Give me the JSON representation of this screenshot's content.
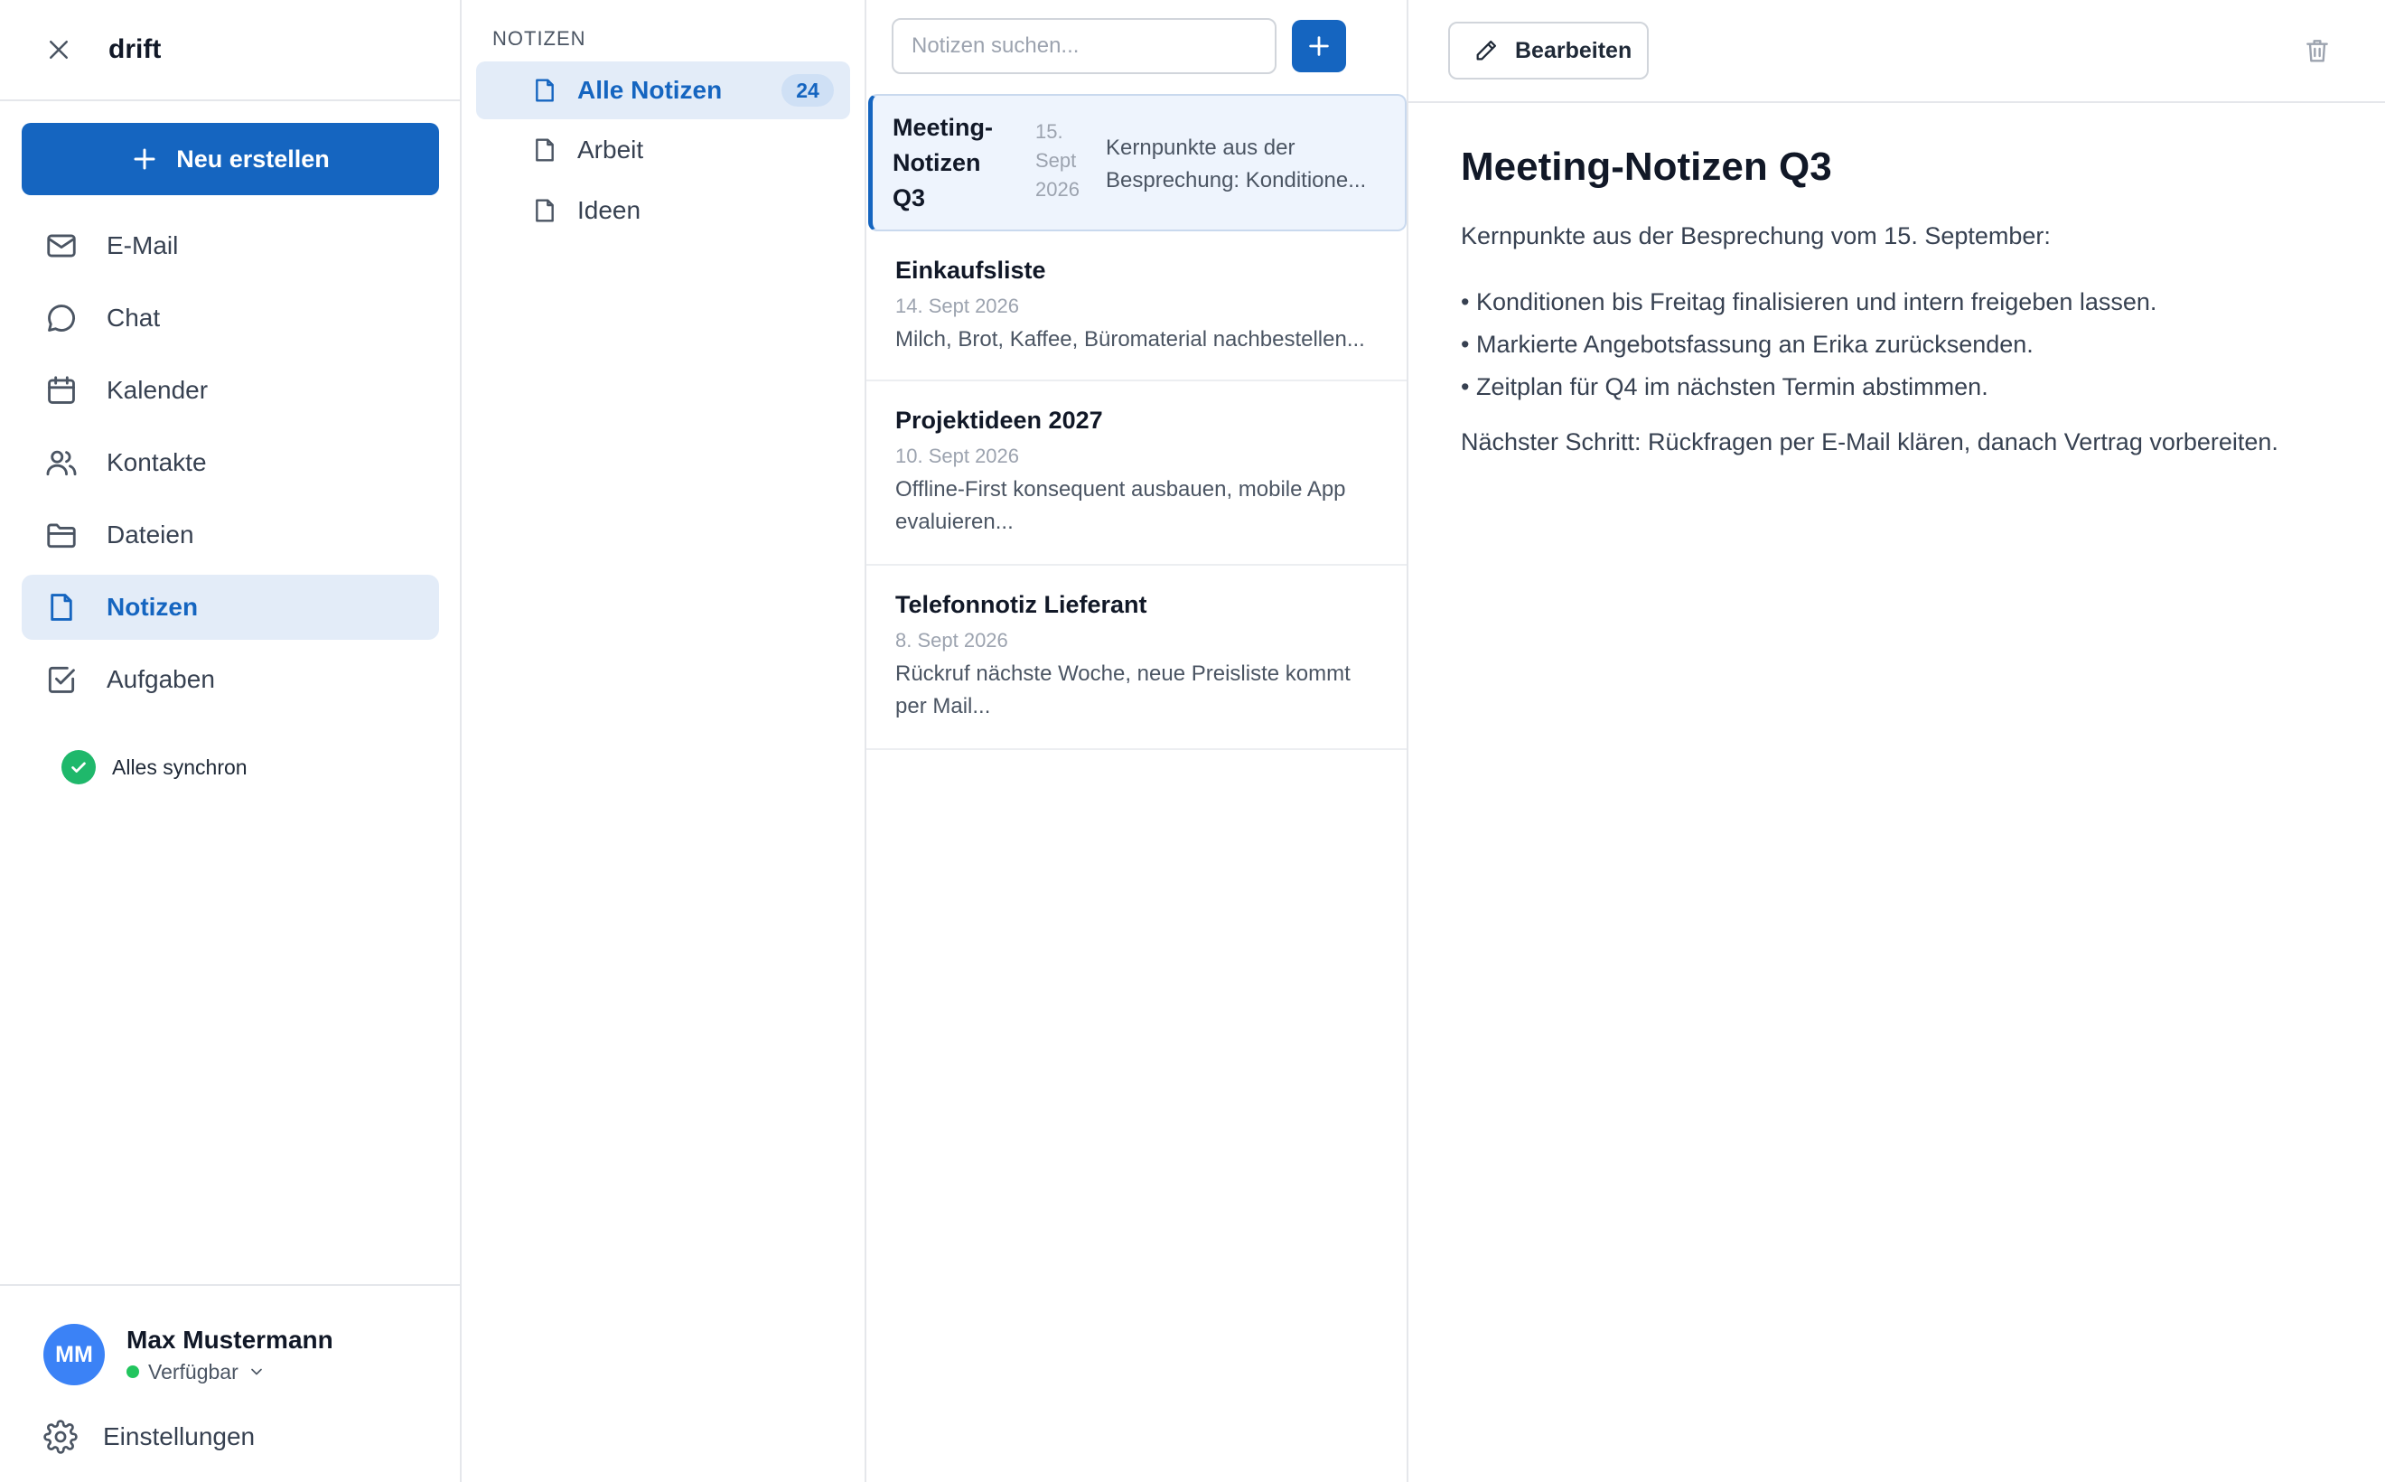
{
  "app": {
    "name": "drift"
  },
  "sidebar": {
    "new_button": "Neu erstellen",
    "items": [
      {
        "label": "E-Mail",
        "icon": "mail-icon"
      },
      {
        "label": "Chat",
        "icon": "chat-icon"
      },
      {
        "label": "Kalender",
        "icon": "calendar-icon"
      },
      {
        "label": "Kontakte",
        "icon": "contacts-icon"
      },
      {
        "label": "Dateien",
        "icon": "folder-icon"
      },
      {
        "label": "Notizen",
        "icon": "note-icon",
        "active": true
      },
      {
        "label": "Aufgaben",
        "icon": "task-icon"
      }
    ],
    "sync_status": "Alles synchron"
  },
  "user": {
    "initials": "MM",
    "name": "Max Mustermann",
    "status": "Verfügbar"
  },
  "settings_label": "Einstellungen",
  "folders": {
    "title": "NOTIZEN",
    "items": [
      {
        "label": "Alle Notizen",
        "count": "24",
        "active": true
      },
      {
        "label": "Arbeit"
      },
      {
        "label": "Ideen"
      }
    ]
  },
  "notes": {
    "search_placeholder": "Notizen suchen...",
    "items": [
      {
        "title": "Meeting-Notizen Q3",
        "date": "15. Sept 2026",
        "preview": "Kernpunkte aus der Besprechung: Konditione...",
        "active": true
      },
      {
        "title": "Einkaufsliste",
        "date": "14. Sept 2026",
        "preview": "Milch, Brot, Kaffee, Büromaterial nachbestellen..."
      },
      {
        "title": "Projektideen 2027",
        "date": "10. Sept 2026",
        "preview": "Offline-First konsequent ausbauen, mobile App evaluieren..."
      },
      {
        "title": "Telefonnotiz Lieferant",
        "date": "8. Sept 2026",
        "preview": "Rückruf nächste Woche, neue Preisliste kommt per Mail..."
      }
    ]
  },
  "detail": {
    "edit_label": "Bearbeiten",
    "title": "Meeting-Notizen Q3",
    "intro": "Kernpunkte aus der Besprechung vom 15. September:",
    "bullets": [
      "• Konditionen bis Freitag finalisieren und intern freigeben lassen.",
      "• Markierte Angebotsfassung an Erika zurücksenden.",
      "• Zeitplan für Q4 im nächsten Termin abstimmen."
    ],
    "next_step": "Nächster Schritt: Rückfragen per E-Mail klären, danach Vertrag vorbereiten."
  },
  "colors": {
    "accent": "#1565c0",
    "active_bg": "#e3ecf8",
    "sync_green": "#1fb86b",
    "avatar": "#3b82f6"
  }
}
